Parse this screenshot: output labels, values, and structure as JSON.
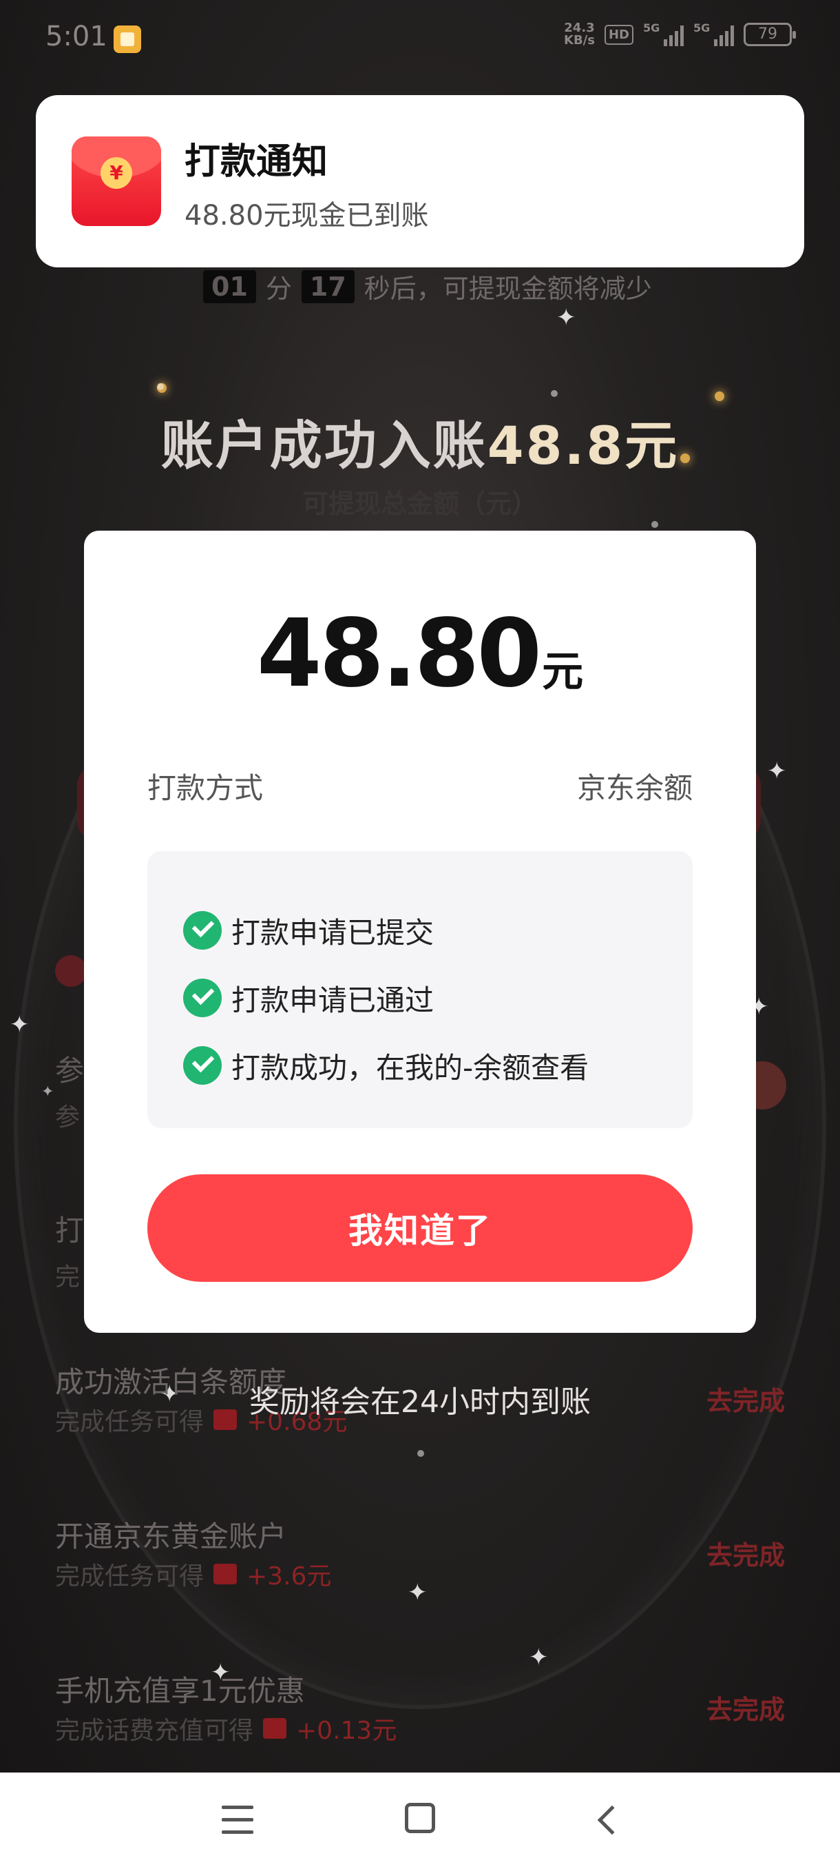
{
  "status_bar": {
    "time": "5:01",
    "net_speed_value": "24.3",
    "net_speed_unit": "KB/s",
    "hd": "HD",
    "network_1": "5G",
    "network_2": "5G",
    "battery": "79"
  },
  "background": {
    "countdown_min": "01",
    "countdown_min_unit": "分",
    "countdown_sec": "17",
    "countdown_suffix": "秒后，可提现金额将减少",
    "success_prefix": "账户成功入账",
    "success_amount": "48.8元",
    "withdraw_label": "可提现总金额（元）",
    "frag_1": "参",
    "frag_2": "参",
    "frag_3": "打",
    "frag_4": "完",
    "tasks": [
      {
        "title": "成功激活白条额度",
        "sub": "完成任务可得",
        "reward": "+0.68元",
        "action": "去完成"
      },
      {
        "title": "开通京东黄金账户",
        "sub": "完成任务可得",
        "reward": "+3.6元",
        "action": "去完成"
      },
      {
        "title": "手机充值享1元优惠",
        "sub": "完成话费充值可得",
        "reward": "+0.13元",
        "action": "去完成"
      }
    ]
  },
  "notification": {
    "title": "打款通知",
    "body": "48.80元现金已到账"
  },
  "modal": {
    "amount": "48.80",
    "unit": "元",
    "pay_method_label": "打款方式",
    "pay_method_value": "京东余额",
    "steps": [
      "打款申请已提交",
      "打款申请已通过",
      "打款成功，在我的-余额查看"
    ],
    "button": "我知道了"
  },
  "reward_note": "奖励将会在24小时内到账"
}
